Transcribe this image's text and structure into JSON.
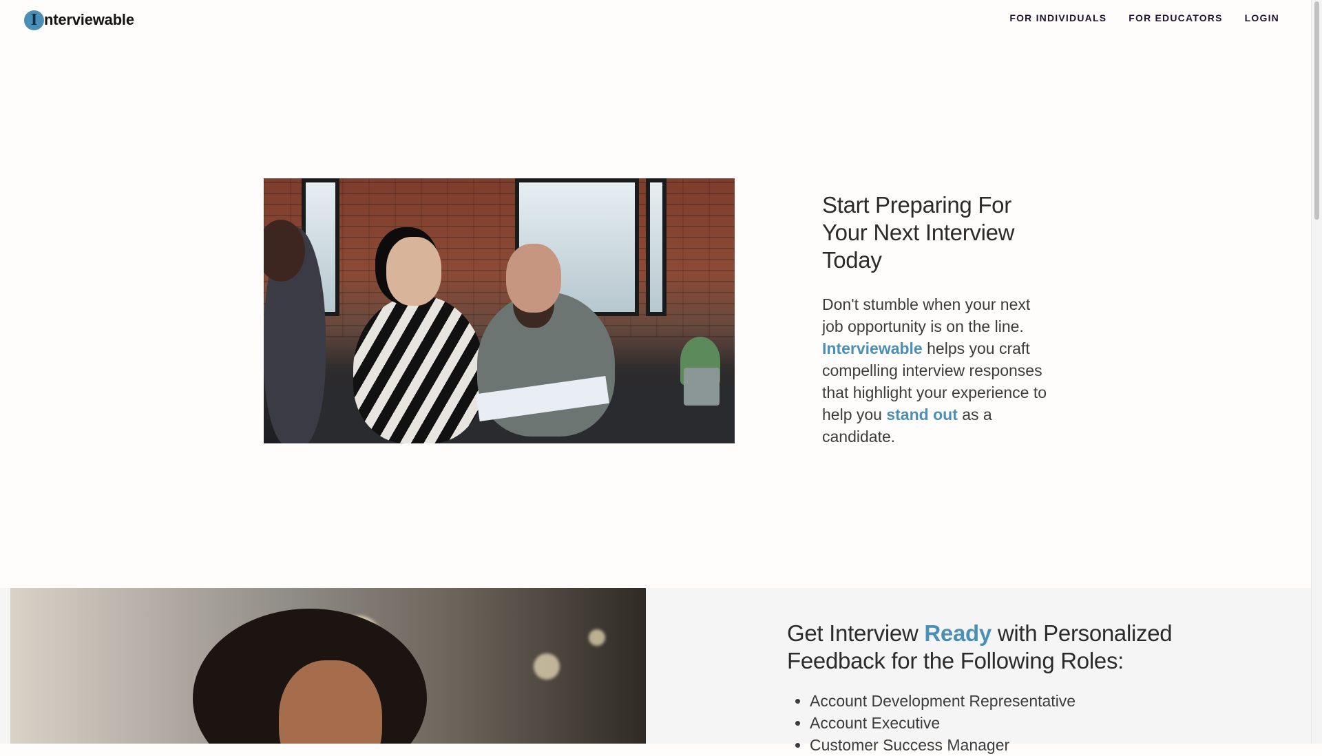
{
  "header": {
    "logo_mark": "I",
    "logo_text": "nterviewable",
    "nav": [
      "FOR INDIVIDUALS",
      "FOR EDUCATORS",
      "LOGIN"
    ]
  },
  "hero": {
    "title": "Start Preparing For Your Next Interview Today",
    "body": {
      "part1": "Don't stumble when your next job opportunity is on the line. ",
      "brand": "Interviewable",
      "part2": " helps you craft compelling interview responses that highlight your experience to help you ",
      "highlight": "stand out",
      "part3": " as a candidate."
    }
  },
  "roles": {
    "title_part1": "Get Interview ",
    "title_highlight": "Ready",
    "title_part2": " with Personalized Feedback for the Following Roles:",
    "items": [
      "Account Development Representative",
      "Account Executive",
      "Customer Success Manager"
    ]
  },
  "colors": {
    "accent": "#4a8fb5",
    "nav_text": "#1e1230",
    "section_bg": "#f5f5f5"
  }
}
